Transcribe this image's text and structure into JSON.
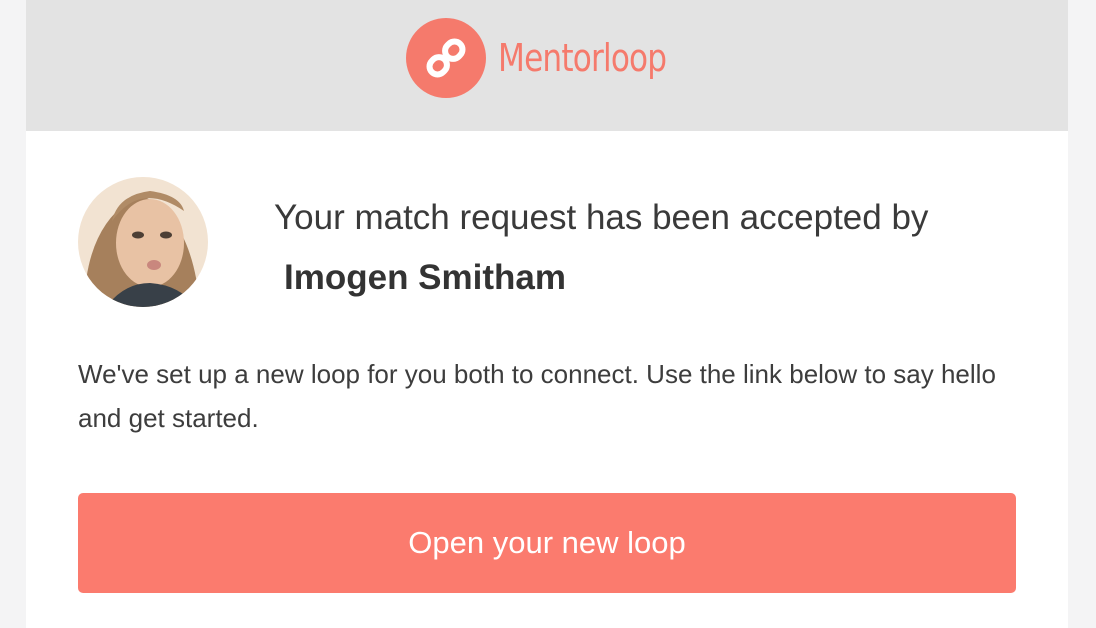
{
  "brand": {
    "name": "Mentorloop",
    "logo_icon": "mentorloop-logo-icon",
    "color": "#f57a6c"
  },
  "avatar": {
    "icon": "user-avatar-photo"
  },
  "message": {
    "headline": "Your match request has been accepted by",
    "mentor_name": "Imogen Smitham",
    "body": "We've set up a new loop for you both to connect. Use the link below to say hello and get started."
  },
  "cta": {
    "label": "Open your new loop",
    "color": "#fb7b6e"
  }
}
